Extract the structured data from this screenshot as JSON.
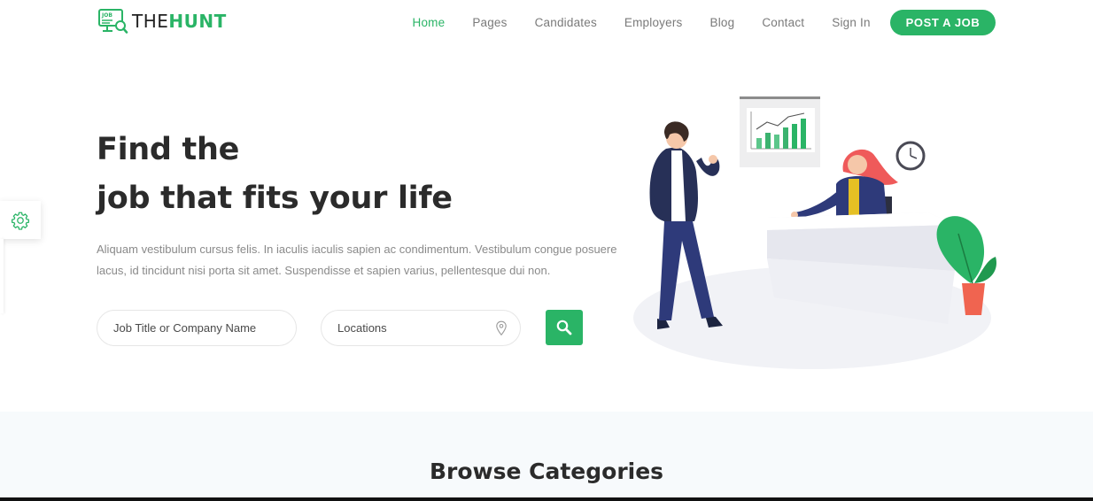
{
  "brand": {
    "logo_badge": "JOB",
    "name_dark": "THE",
    "name_green": "HUNT",
    "accent_color": "#2ab466"
  },
  "nav": {
    "items": [
      {
        "label": "Home",
        "active": true
      },
      {
        "label": "Pages",
        "active": false
      },
      {
        "label": "Candidates",
        "active": false
      },
      {
        "label": "Employers",
        "active": false
      },
      {
        "label": "Blog",
        "active": false
      },
      {
        "label": "Contact",
        "active": false
      },
      {
        "label": "Sign In",
        "active": false
      }
    ],
    "cta_label": "POST A JOB"
  },
  "hero": {
    "title_line1": "Find the",
    "title_line2": "job that fits your life",
    "description": "Aliquam vestibulum cursus felis. In iaculis iaculis sapien ac condimentum. Vestibulum congue posuere lacus, id tincidunt nisi porta sit amet. Suspendisse et sapien varius, pellentesque dui non.",
    "search": {
      "job_placeholder": "Job Title or Company Name",
      "location_placeholder": "Locations",
      "button_icon": "search-icon",
      "location_icon": "map-pin-icon"
    }
  },
  "settings": {
    "icon": "gear-icon"
  },
  "browse": {
    "title": "Browse Categories"
  }
}
